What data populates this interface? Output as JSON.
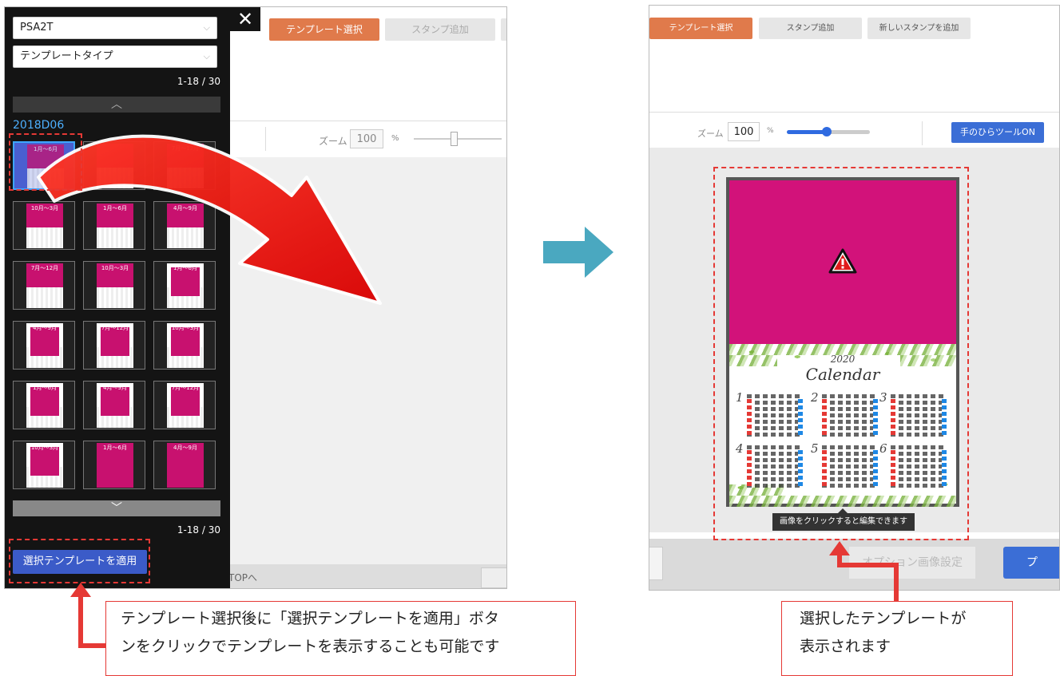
{
  "left": {
    "panel": {
      "select1": "PSA2T",
      "select2": "テンプレートタイプ",
      "pager_top": "1-18 / 30",
      "pager_bottom": "1-18 / 30",
      "group_title": "2018D06",
      "apply_button": "選択テンプレートを適用",
      "close": "✕",
      "thumbnails": [
        {
          "label": "1月～6月",
          "style": "normal"
        },
        {
          "label": "",
          "style": "normal"
        },
        {
          "label": "7月～12月",
          "style": "normal"
        },
        {
          "label": "10月～3月",
          "style": "normal"
        },
        {
          "label": "1月～6月",
          "style": "normal"
        },
        {
          "label": "4月～9月",
          "style": "normal"
        },
        {
          "label": "7月～12月",
          "style": "normal"
        },
        {
          "label": "10月～3月",
          "style": "normal"
        },
        {
          "label": "1月～6月",
          "style": "frame"
        },
        {
          "label": "4月～9月",
          "style": "frame"
        },
        {
          "label": "7月～12月",
          "style": "frame"
        },
        {
          "label": "10月～3月",
          "style": "frame"
        },
        {
          "label": "1月～6月",
          "style": "frame"
        },
        {
          "label": "4月～9月",
          "style": "frame"
        },
        {
          "label": "7月～12月",
          "style": "frame"
        },
        {
          "label": "10月～3月",
          "style": "frame"
        },
        {
          "label": "1月～6月",
          "style": "full"
        },
        {
          "label": "4月～9月",
          "style": "full"
        }
      ]
    },
    "toolbar": {
      "tab_template": "テンプレート選択",
      "tab_stamp": "スタンプ追加"
    },
    "zoom": {
      "label": "ズーム",
      "value": "100",
      "unit": "%"
    },
    "bottom_text": "TOPへ"
  },
  "right": {
    "toolbar": {
      "tab_template": "テンプレート選択",
      "tab_stamp": "スタンプ追加",
      "tab_new_stamp": "新しいスタンプを追加"
    },
    "zoom": {
      "label": "ズーム",
      "value": "100",
      "unit": "%"
    },
    "hand_tool": "手のひらツールON",
    "calendar": {
      "year": "2020",
      "title": "Calendar",
      "months": [
        "1",
        "2",
        "3",
        "4",
        "5",
        "6"
      ]
    },
    "tooltip": "画像をクリックすると編集できます",
    "option_button": "オプション画像設定",
    "preview_button": "プ"
  },
  "callouts": {
    "left_line1": "テンプレート選択後に「選択テンプレートを適用」ボタ",
    "left_line2": "ンをクリックでテンプレートを表示することも可能です",
    "right_line1": "選択したテンプレートが",
    "right_line2": "表示されます"
  },
  "colors": {
    "accent_orange": "#e07a4b",
    "brand_blue": "#3b5bc8",
    "highlight_red": "#e53935",
    "template_pink": "#d2127a",
    "step_arrow": "#4aa8c0"
  }
}
